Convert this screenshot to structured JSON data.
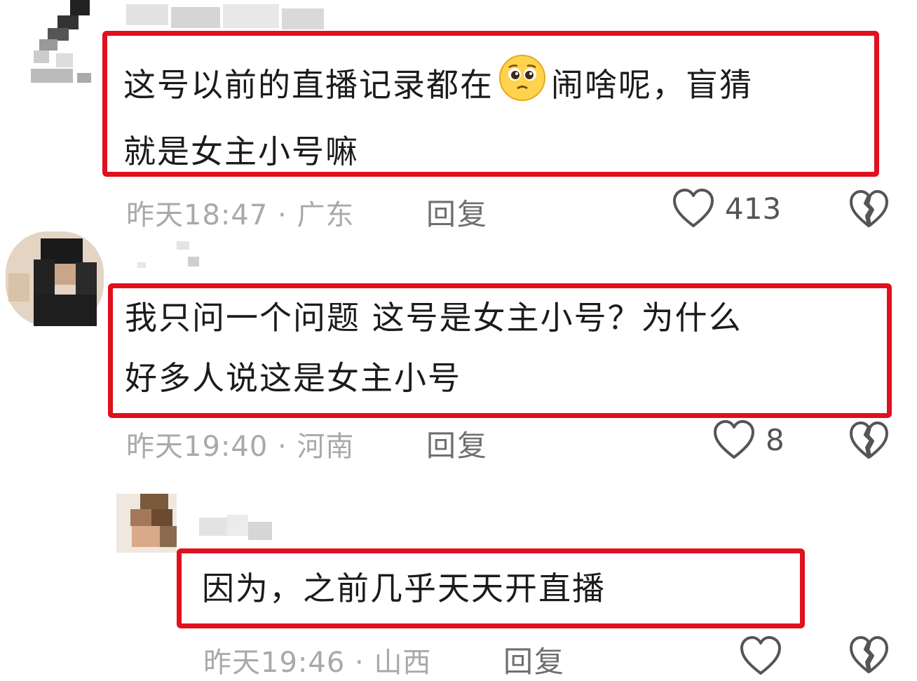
{
  "colors": {
    "highlight_border": "#e0101e",
    "meta_text": "#a9a9a9",
    "reply_text": "#6f6f6f",
    "comment_text": "#1b1b1b"
  },
  "comments": [
    {
      "text_line1_a": "这号以前的直播记录都在",
      "emoji": "pleading-face-emoji",
      "text_line1_b": "闹啥呢，盲猜",
      "text_line2": "就是女主小号嘛",
      "time": "昨天18:47",
      "location": "广东",
      "reply_label": "回复",
      "likes": "413"
    },
    {
      "text_line1": "我只问一个问题 这号是女主小号？为什么",
      "text_line2": "好多人说这是女主小号",
      "time": "昨天19:40",
      "location": "河南",
      "reply_label": "回复",
      "likes": "8"
    },
    {
      "text_line1": "因为，之前几乎天天开直播",
      "time": "昨天19:46",
      "location": "山西",
      "reply_label": "回复",
      "likes": ""
    }
  ],
  "icons": {
    "like": "heart-icon",
    "dislike": "broken-heart-icon"
  },
  "separator": "·"
}
